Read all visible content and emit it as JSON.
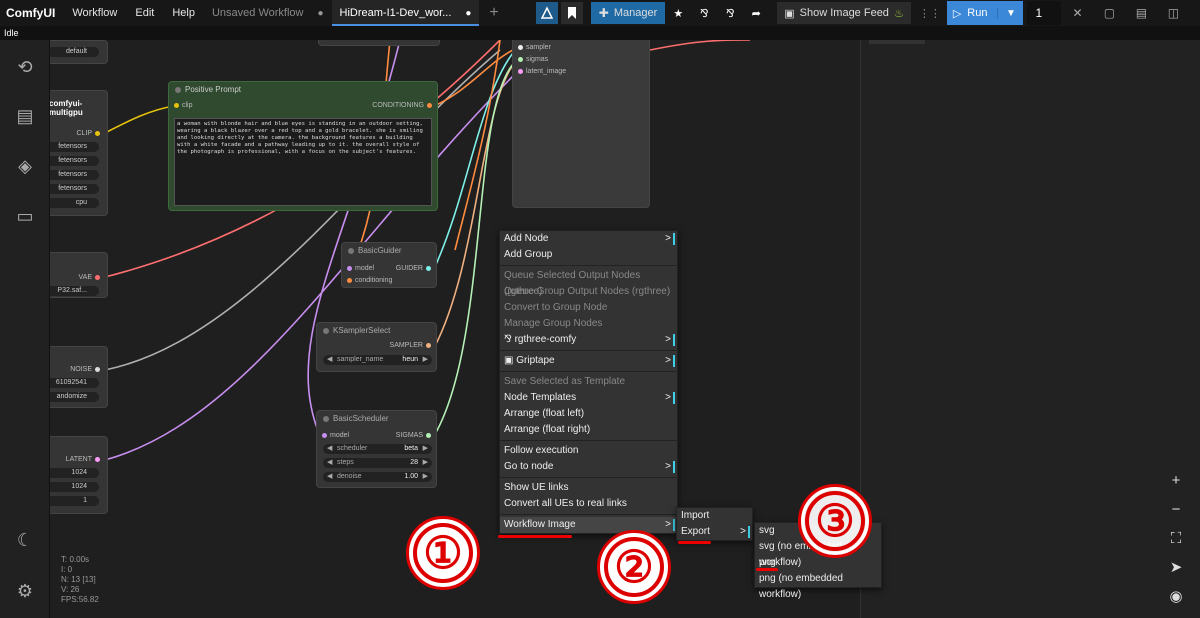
{
  "topbar": {
    "logo": "ComfyUI",
    "menu": [
      "Workflow",
      "Edit",
      "Help"
    ],
    "tabs": [
      {
        "label": "Unsaved Workflow",
        "active": false
      },
      {
        "label": "HiDream-I1-Dev_wor...",
        "active": true
      }
    ],
    "manager_label": "Manager",
    "image_feed_label": "Show Image Feed",
    "run_label": "Run",
    "queue_count": "1"
  },
  "status": "Idle",
  "sidebar_icons": [
    "history-icon",
    "queue-icon",
    "model-library-icon",
    "workflows-icon",
    "theme-toggle-icon",
    "settings-icon"
  ],
  "left_nodes": {
    "default_widget": "default",
    "multigpu_title": "comfyui-multigpu",
    "clip_label": "CLIP",
    "file_widgets": [
      "fetensors",
      "fetensors",
      "fetensors",
      "fetensors"
    ],
    "device_widget": "cpu",
    "vae_label": "VAE",
    "vae_file": "P32.saf...",
    "noise_label": "NOISE",
    "seed": "61092541",
    "control": "andomize",
    "latent_label": "LATENT",
    "width": "1024",
    "height": "1024",
    "batch": "1"
  },
  "positive_prompt": {
    "title": "Positive Prompt",
    "input": "clip",
    "output": "CONDITIONING",
    "text": "a woman with blonde hair and blue eyes is standing in an outdoor setting, wearing a black blazer over a red top and a gold bracelet. she is smiling and looking directly at the camera. the background features a building with a white facade and a pathway leading up to it. the overall style of the photograph is professional, with a focus on the subject's features."
  },
  "sampler_node": {
    "inputs": [
      "sampler",
      "sigmas",
      "latent_image"
    ]
  },
  "basic_guider": {
    "title": "BasicGuider",
    "inputs": [
      "model",
      "conditioning"
    ],
    "output": "GUIDER"
  },
  "ksampler_select": {
    "title": "KSamplerSelect",
    "output": "SAMPLER",
    "widget_label": "sampler_name",
    "widget_value": "heun"
  },
  "basic_scheduler": {
    "title": "BasicScheduler",
    "input": "model",
    "output": "SIGMAS",
    "widgets": [
      {
        "label": "scheduler",
        "value": "beta"
      },
      {
        "label": "steps",
        "value": "28"
      },
      {
        "label": "denoise",
        "value": "1.00"
      }
    ]
  },
  "context_menu": {
    "items": [
      {
        "label": "Add Node",
        "disabled": false,
        "submenu": true
      },
      {
        "label": "Add Group",
        "disabled": false,
        "submenu": false
      },
      {
        "sep": true
      },
      {
        "label": "Queue Selected Output Nodes (rgthree)",
        "disabled": true
      },
      {
        "label": "Queue Group Output Nodes (rgthree)",
        "disabled": true
      },
      {
        "label": "Convert to Group Node",
        "disabled": true
      },
      {
        "label": "Manage Group Nodes",
        "disabled": true
      },
      {
        "label": "rgthree-comfy",
        "disabled": false,
        "submenu": true,
        "icon": true
      },
      {
        "sep": true
      },
      {
        "label": "Griptape",
        "disabled": false,
        "submenu": true,
        "icon": true
      },
      {
        "sep": true
      },
      {
        "label": "Save Selected as Template",
        "disabled": true
      },
      {
        "label": "Node Templates",
        "disabled": false,
        "submenu": true
      },
      {
        "label": "Arrange (float left)",
        "disabled": false
      },
      {
        "label": "Arrange (float right)",
        "disabled": false
      },
      {
        "sep": true
      },
      {
        "label": "Follow execution",
        "disabled": false
      },
      {
        "label": "Go to node",
        "disabled": false,
        "submenu": true
      },
      {
        "sep": true
      },
      {
        "label": "Show UE links",
        "disabled": false
      },
      {
        "label": "Convert all UEs to real links",
        "disabled": false
      },
      {
        "sep": true
      },
      {
        "label": "Workflow Image",
        "disabled": false,
        "submenu": true
      }
    ]
  },
  "submenu_workflow_image": [
    "Import",
    "Export"
  ],
  "submenu_export": [
    "svg",
    "svg (no embedded workflow)",
    "png",
    "png (no embedded workflow)"
  ],
  "annotations": [
    "①",
    "②",
    "③"
  ],
  "stats": [
    "T: 0.00s",
    "I: 0",
    "N: 13 [13]",
    "V: 26",
    "FPS:56.82"
  ],
  "colors": {
    "accent": "#3c88d8",
    "highlight": "#3fd0e8",
    "annotation_red": "#dd0000"
  }
}
